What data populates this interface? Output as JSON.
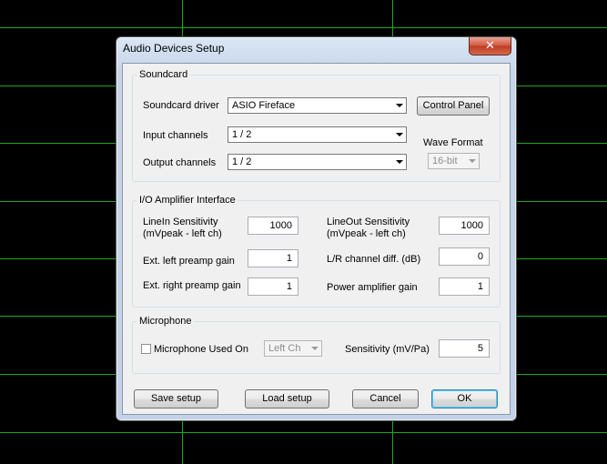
{
  "dialog": {
    "title": "Audio Devices Setup",
    "close_glyph": "✕"
  },
  "soundcard": {
    "legend": "Soundcard",
    "driver_label": "Soundcard driver",
    "driver_value": "ASIO Fireface",
    "control_panel_label": "Control Panel",
    "input_label": "Input channels",
    "input_value": "1 / 2",
    "output_label": "Output channels",
    "output_value": "1 / 2",
    "wave_format_label": "Wave Format",
    "wave_format_value": "16-bit"
  },
  "io": {
    "legend": "I/O Amplifier Interface",
    "linein_label_1": "LineIn Sensitivity",
    "linein_label_2": "(mVpeak - left ch)",
    "linein_value": "1000",
    "lineout_label_1": "LineOut Sensitivity",
    "lineout_label_2": "(mVpeak - left ch)",
    "lineout_value": "1000",
    "left_gain_label": "Ext. left preamp gain",
    "left_gain_value": "1",
    "lr_diff_label": "L/R channel diff. (dB)",
    "lr_diff_value": "0",
    "right_gain_label": "Ext. right preamp gain",
    "right_gain_value": "1",
    "power_gain_label": "Power amplifier gain",
    "power_gain_value": "1"
  },
  "microphone": {
    "legend": "Microphone",
    "used_on_label": "Microphone Used On",
    "channel_value": "Left Ch",
    "sensitivity_label": "Sensitivity (mV/Pa)",
    "sensitivity_value": "5"
  },
  "buttons": {
    "save": "Save setup",
    "load": "Load setup",
    "cancel": "Cancel",
    "ok": "OK"
  }
}
